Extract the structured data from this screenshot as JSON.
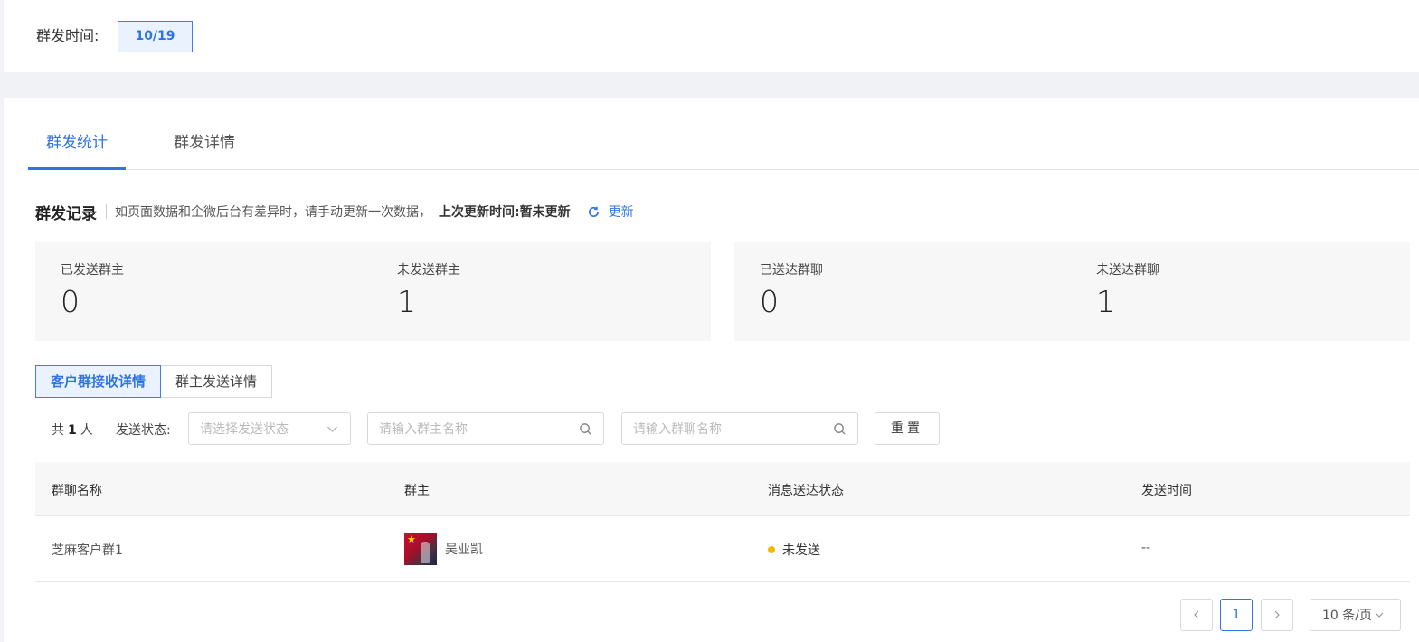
{
  "top": {
    "send_time_label": "群发时间:",
    "date_chip": "10/19"
  },
  "tabs": [
    {
      "label": "群发统计",
      "active": true
    },
    {
      "label": "群发详情",
      "active": false
    }
  ],
  "record": {
    "title": "群发记录",
    "hint": "如页面数据和企微后台有差异时，请手动更新一次数据，",
    "last_update_label": "上次更新时间:",
    "last_update_value": "暂未更新",
    "refresh_label": "更新"
  },
  "stats": [
    {
      "label": "已发送群主",
      "value": "0"
    },
    {
      "label": "未发送群主",
      "value": "1"
    },
    {
      "label": "已送达群聊",
      "value": "0"
    },
    {
      "label": "未送达群聊",
      "value": "1"
    }
  ],
  "subtabs": [
    {
      "label": "客户群接收详情",
      "active": true
    },
    {
      "label": "群主发送详情",
      "active": false
    }
  ],
  "filters": {
    "count_prefix": "共",
    "count_value": "1",
    "count_suffix": "人",
    "status_label": "发送状态:",
    "status_placeholder": "请选择发送状态",
    "owner_placeholder": "请输入群主名称",
    "group_placeholder": "请输入群聊名称",
    "reset_label": "重置"
  },
  "table": {
    "columns": [
      "群聊名称",
      "群主",
      "消息送达状态",
      "发送时间"
    ],
    "rows": [
      {
        "group_name": "芝麻客户群1",
        "owner": "吴业凯",
        "status": "未发送",
        "send_time": "--"
      }
    ]
  },
  "pagination": {
    "current_page": "1",
    "page_size": "10 条/页"
  },
  "colors": {
    "accent": "#2f74e0",
    "status_pending": "#f5b800"
  }
}
